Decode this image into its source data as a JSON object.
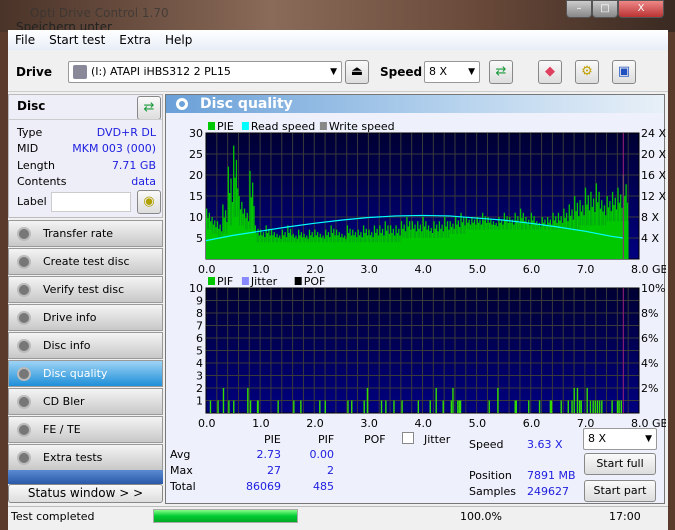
{
  "window": {
    "title": "Opti Drive Control 1.70",
    "background_title": "Speichern unter",
    "controls": [
      "–",
      "□",
      "X"
    ]
  },
  "menu": [
    "File",
    "Start test",
    "Extra",
    "Help"
  ],
  "toolbar": {
    "drive_label": "Drive",
    "drive_value": "(I:)  ATAPI iHBS312  2 PL15",
    "speed_label": "Speed",
    "speed_value": "8 X"
  },
  "disc": {
    "title": "Disc",
    "rows": [
      {
        "k": "Type",
        "v": "DVD+R DL"
      },
      {
        "k": "MID",
        "v": "MKM 003 (000)"
      },
      {
        "k": "Length",
        "v": "7.71 GB"
      },
      {
        "k": "Contents",
        "v": "data"
      }
    ],
    "label_label": "Label",
    "label_value": ""
  },
  "nav": [
    {
      "label": "Transfer rate"
    },
    {
      "label": "Create test disc"
    },
    {
      "label": "Verify test disc"
    },
    {
      "label": "Drive info"
    },
    {
      "label": "Disc info"
    },
    {
      "label": "Disc quality",
      "active": true
    },
    {
      "label": "CD Bler"
    },
    {
      "label": "FE / TE"
    },
    {
      "label": "Extra tests"
    }
  ],
  "status_window_label": "Status window > >",
  "panel_title": "Disc quality",
  "chart_data": [
    {
      "type": "bar",
      "legend": [
        "PIE",
        "Read speed",
        "Write speed"
      ],
      "colors": {
        "PIE": "#00c800",
        "Read speed": "#00ffff",
        "Write speed": "#888888"
      },
      "x_unit": "GB",
      "xlim": [
        0,
        8
      ],
      "x_ticks": [
        "0.0",
        "1.0",
        "2.0",
        "3.0",
        "4.0",
        "5.0",
        "6.0",
        "7.0",
        "8.0 GB"
      ],
      "ylim": [
        0,
        30
      ],
      "y_ticks": [
        "5",
        "10",
        "15",
        "20",
        "25",
        "30"
      ],
      "y2lim": [
        0,
        24
      ],
      "y2_ticks": [
        "4 X",
        "8 X",
        "12 X",
        "16 X",
        "20 X",
        "24 X"
      ],
      "grid": true,
      "end_marker_gb": 7.71,
      "pie_step_gb": 0.1,
      "pie_values": [
        12,
        10,
        9,
        13,
        22,
        27,
        15,
        12,
        21,
        8,
        7,
        8,
        7,
        6,
        7,
        8,
        6,
        7,
        6,
        7,
        7,
        6,
        7,
        8,
        7,
        6,
        8,
        7,
        7,
        8,
        7,
        8,
        8,
        9,
        8,
        8,
        9,
        10,
        9,
        9,
        10,
        8,
        9,
        9,
        10,
        9,
        10,
        11,
        10,
        10,
        10,
        11,
        10,
        9,
        10,
        11,
        10,
        11,
        12,
        10,
        11,
        9,
        10,
        10,
        11,
        11,
        12,
        13,
        15,
        14,
        17,
        16,
        18,
        14,
        15,
        16,
        17,
        20
      ],
      "pie_floor": [
        7,
        6,
        5,
        6,
        8,
        10,
        8,
        7,
        7,
        4,
        4,
        4,
        4,
        4,
        4,
        4,
        4,
        4,
        4,
        4,
        4,
        4,
        4,
        4,
        4,
        4,
        4,
        4,
        4,
        4,
        4,
        4,
        4,
        4,
        4,
        4,
        5,
        5,
        5,
        5,
        5,
        5,
        5,
        5,
        5,
        6,
        6,
        6,
        7,
        7,
        7,
        7,
        7,
        7,
        7,
        7,
        7,
        7,
        7,
        7,
        7,
        7,
        7,
        7,
        7,
        7,
        7,
        7,
        7,
        8,
        8,
        8,
        8,
        8,
        9,
        9,
        9,
        9
      ],
      "read_speed": {
        "x": [
          0,
          0.5,
          1,
          1.5,
          2,
          2.5,
          3,
          3.5,
          4,
          4.5,
          5,
          5.5,
          6,
          6.5,
          7,
          7.5,
          7.71
        ],
        "y": [
          3.5,
          4.5,
          5.3,
          6.1,
          6.8,
          7.4,
          7.9,
          8.2,
          8.3,
          8.2,
          7.8,
          7.4,
          6.8,
          6.1,
          5.3,
          4.3,
          4.0
        ]
      }
    },
    {
      "type": "bar",
      "legend": [
        "PIF",
        "Jitter",
        "POF"
      ],
      "colors": {
        "PIF": "#00c800",
        "Jitter": "#8888ff",
        "POF": "#000000"
      },
      "x_unit": "GB",
      "xlim": [
        0,
        8
      ],
      "x_ticks": [
        "0.0",
        "1.0",
        "2.0",
        "3.0",
        "4.0",
        "5.0",
        "6.0",
        "7.0",
        "8.0 GB"
      ],
      "ylim": [
        0,
        10
      ],
      "y_ticks": [
        "1",
        "2",
        "3",
        "4",
        "5",
        "6",
        "7",
        "8",
        "9",
        "10"
      ],
      "y2_ticks": [
        "2%",
        "4%",
        "6%",
        "8%",
        "10%"
      ],
      "grid": true,
      "end_marker_gb": 7.71,
      "pif": [
        [
          0.07,
          1
        ],
        [
          0.21,
          1
        ],
        [
          0.31,
          2
        ],
        [
          0.41,
          1
        ],
        [
          0.5,
          1
        ],
        [
          0.76,
          2
        ],
        [
          0.81,
          1
        ],
        [
          0.94,
          1
        ],
        [
          0.95,
          1
        ],
        [
          1.32,
          1
        ],
        [
          1.61,
          1
        ],
        [
          1.74,
          1
        ],
        [
          2.09,
          1
        ],
        [
          2.19,
          1
        ],
        [
          2.61,
          1
        ],
        [
          2.68,
          1
        ],
        [
          2.91,
          1
        ],
        [
          2.97,
          2
        ],
        [
          3.23,
          1
        ],
        [
          3.31,
          1
        ],
        [
          3.46,
          1
        ],
        [
          3.61,
          1
        ],
        [
          3.91,
          1
        ],
        [
          4.13,
          1
        ],
        [
          4.24,
          2
        ],
        [
          4.37,
          1
        ],
        [
          4.52,
          1
        ],
        [
          4.55,
          2
        ],
        [
          4.64,
          1
        ],
        [
          4.67,
          1
        ],
        [
          4.69,
          1
        ],
        [
          5.22,
          1
        ],
        [
          5.38,
          2
        ],
        [
          5.7,
          1
        ],
        [
          5.72,
          1
        ],
        [
          5.95,
          1
        ],
        [
          6.15,
          1
        ],
        [
          6.35,
          1
        ],
        [
          6.37,
          1
        ],
        [
          6.55,
          1
        ],
        [
          6.68,
          1
        ],
        [
          6.75,
          1
        ],
        [
          6.79,
          2
        ],
        [
          6.85,
          2
        ],
        [
          6.89,
          1
        ],
        [
          6.92,
          1
        ],
        [
          7.03,
          2
        ],
        [
          7.09,
          1
        ],
        [
          7.14,
          1
        ],
        [
          7.18,
          1
        ],
        [
          7.22,
          1
        ],
        [
          7.26,
          1
        ],
        [
          7.3,
          1
        ],
        [
          7.49,
          1
        ],
        [
          7.59,
          1
        ],
        [
          7.62,
          1
        ],
        [
          7.66,
          1
        ]
      ]
    }
  ],
  "stats": {
    "headers": [
      "PIE",
      "PIF",
      "POF"
    ],
    "jitter_label": "Jitter",
    "jitter_checked": false,
    "rows": [
      {
        "k": "Avg",
        "pie": "2.73",
        "pif": "0.00"
      },
      {
        "k": "Max",
        "pie": "27",
        "pif": "2"
      },
      {
        "k": "Total",
        "pie": "86069",
        "pif": "485"
      }
    ],
    "speed_label": "Speed",
    "speed": "3.63 X",
    "position_label": "Position",
    "position": "7891 MB",
    "samples_label": "Samples",
    "samples": "249627",
    "speed_select": "8 X",
    "start_full": "Start full",
    "start_part": "Start part"
  },
  "statusbar": {
    "text": "Test completed",
    "progress": 100,
    "progress_text": "100.0%",
    "time": "17:00"
  }
}
